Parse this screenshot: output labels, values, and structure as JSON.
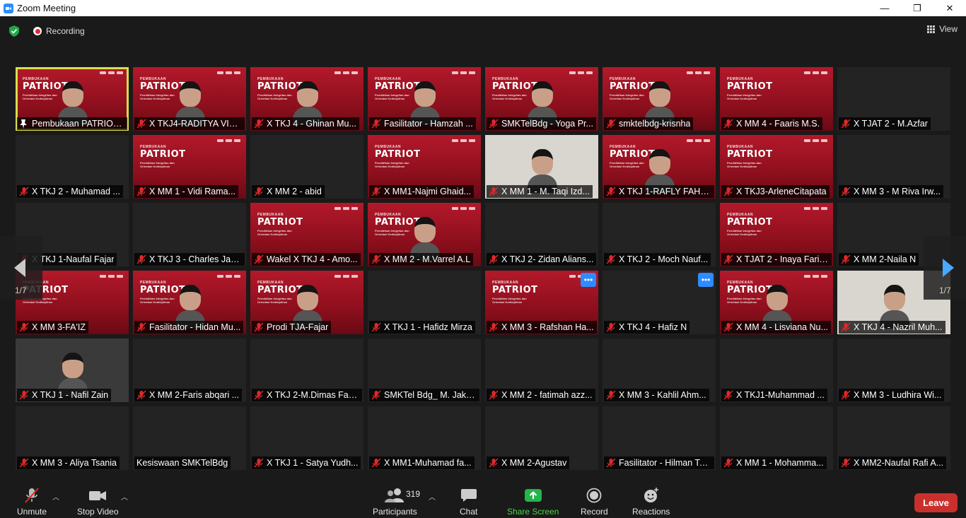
{
  "window": {
    "title": "Zoom Meeting",
    "minimize": "—",
    "maximize": "❐",
    "close": "✕"
  },
  "topbar": {
    "recording_label": "Recording",
    "view_label": "View"
  },
  "pagination": {
    "left": "1/7",
    "right": "1/7"
  },
  "tiles": [
    {
      "name": "Pembukaan PATRIOT ...",
      "kind": "slide-person",
      "active": true,
      "pinned": true
    },
    {
      "name": "X TKJ4-RADITYA VIHA...",
      "kind": "slide-person"
    },
    {
      "name": "X TKJ 4 - Ghinan Mu...",
      "kind": "slide-person"
    },
    {
      "name": "Fasilitator - Hamzah ...",
      "kind": "slide-person"
    },
    {
      "name": "SMKTelBdg - Yoga Pr...",
      "kind": "slide-person"
    },
    {
      "name": "smktelbdg-krisnha",
      "kind": "slide-person"
    },
    {
      "name": "X MM 4 - Faaris M.S.",
      "kind": "slide"
    },
    {
      "name": "X TJAT 2 - M.Azfar",
      "kind": "empty"
    },
    {
      "name": "X TKJ 2 - Muhamad ...",
      "kind": "empty"
    },
    {
      "name": "X MM 1 - Vidi Rama...",
      "kind": "slide"
    },
    {
      "name": "X MM 2 - abid",
      "kind": "empty"
    },
    {
      "name": "X MM1-Najmi Ghaid...",
      "kind": "slide"
    },
    {
      "name": "X MM 1 - M. Taqi Izd...",
      "kind": "cam-light"
    },
    {
      "name": "X TKJ 1-RAFLY FAHRE...",
      "kind": "slide-person"
    },
    {
      "name": "X TKJ3-ArleneCitapata",
      "kind": "slide"
    },
    {
      "name": "X MM 3 - M Riva Irw...",
      "kind": "empty"
    },
    {
      "name": "X TKJ 1-Naufal Fajar",
      "kind": "empty"
    },
    {
      "name": "X TKJ 3 - Charles Jan...",
      "kind": "empty"
    },
    {
      "name": "Wakel X TKJ 4 - Amo...",
      "kind": "slide"
    },
    {
      "name": "X MM 2 - M.Varrel A.L",
      "kind": "slide-person"
    },
    {
      "name": "X TKJ 2- Zidan Alians...",
      "kind": "empty"
    },
    {
      "name": "X TKJ 2 - Moch Nauf...",
      "kind": "empty"
    },
    {
      "name": "X TJAT 2 - Inaya Farid...",
      "kind": "slide"
    },
    {
      "name": "X MM 2-Naila N",
      "kind": "empty"
    },
    {
      "name": "X MM 3-FA'IZ",
      "kind": "slide"
    },
    {
      "name": "Fasilitator - Hidan Mu...",
      "kind": "slide-person"
    },
    {
      "name": "Prodi TJA-Fajar",
      "kind": "slide-person"
    },
    {
      "name": "X TKJ 1 - Hafidz Mirza",
      "kind": "empty"
    },
    {
      "name": "X MM 3 - Rafshan Ha...",
      "kind": "slide",
      "more": true
    },
    {
      "name": "X TKJ 4 - Hafiz N",
      "kind": "empty",
      "more": true
    },
    {
      "name": "X MM 4 - Lisviana Nu...",
      "kind": "slide-person"
    },
    {
      "name": "X TKJ 4 - Nazril Muh...",
      "kind": "cam-light"
    },
    {
      "name": "X TKJ 1 - Nafil Zain",
      "kind": "cam"
    },
    {
      "name": "X MM 2-Faris abqari ...",
      "kind": "empty"
    },
    {
      "name": "X TKJ 2-M.Dimas Fah...",
      "kind": "empty"
    },
    {
      "name": "SMKTel Bdg_ M. Jaka...",
      "kind": "empty"
    },
    {
      "name": "X MM 2 - fatimah azz...",
      "kind": "empty"
    },
    {
      "name": "X MM 3 - Kahlil Ahm...",
      "kind": "empty"
    },
    {
      "name": "X TKJ1-Muhammad ...",
      "kind": "empty"
    },
    {
      "name": "X MM 3 - Ludhira Wi...",
      "kind": "empty"
    },
    {
      "name": "X MM 3 - Aliya Tsania",
      "kind": "empty"
    },
    {
      "name": "Kesiswaan SMKTelBdg",
      "kind": "empty",
      "nomic": true
    },
    {
      "name": "X TKJ 1 - Satya Yudh...",
      "kind": "empty"
    },
    {
      "name": "X MM1-Muhamad fa...",
      "kind": "empty"
    },
    {
      "name": "X MM 2-Agustav",
      "kind": "empty"
    },
    {
      "name": "Fasilitator - Hilman Ta...",
      "kind": "empty"
    },
    {
      "name": "X MM 1 - Mohamma...",
      "kind": "empty"
    },
    {
      "name": "X MM2-Naufal Rafi A...",
      "kind": "empty"
    }
  ],
  "slide": {
    "line1": "PEMBUKAAN",
    "line2": "PATRIOT",
    "line3": "Pendidikan Integritas dan Orientasi Kedisiplinan"
  },
  "toolbar": {
    "unmute": "Unmute",
    "stop_video": "Stop Video",
    "participants": "Participants",
    "participants_count": "319",
    "chat": "Chat",
    "share_screen": "Share Screen",
    "record": "Record",
    "reactions": "Reactions",
    "leave": "Leave"
  },
  "colors": {
    "accent": "#2d8cff",
    "slide_red": "#b3192a",
    "share_green": "#4cd34c",
    "leave_red": "#c9302c",
    "active_border": "#d6e04a"
  }
}
